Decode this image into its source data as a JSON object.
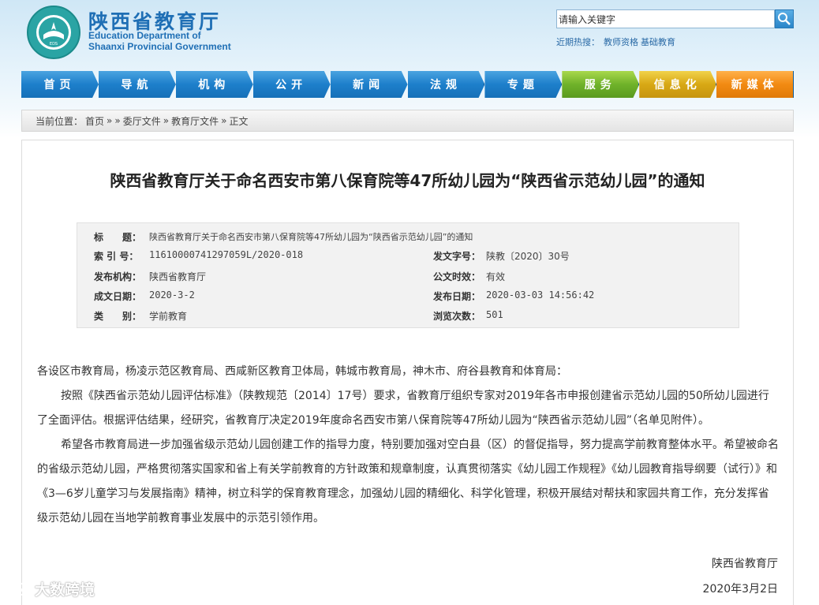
{
  "header": {
    "site_name_cn": "陕西省教育厅",
    "site_name_en_line1": "Education Department of",
    "site_name_en_line2": "Shaanxi Provincial Government",
    "logo_text_outer": "EDUCATION DEPARTMENT OF SHAANXI",
    "logo_text_inner": "EDS",
    "search_placeholder": "请输入关键字",
    "search_value": "请输入关键字",
    "hot_label": "近期热搜：",
    "hot_links": [
      "教师资格",
      "基础教育"
    ]
  },
  "nav": {
    "items": [
      {
        "label": "首页",
        "color": "blue"
      },
      {
        "label": "导航",
        "color": "blue"
      },
      {
        "label": "机构",
        "color": "blue"
      },
      {
        "label": "公开",
        "color": "blue"
      },
      {
        "label": "新闻",
        "color": "blue"
      },
      {
        "label": "法规",
        "color": "blue"
      },
      {
        "label": "专题",
        "color": "blue"
      },
      {
        "label": "服务",
        "color": "green"
      },
      {
        "label": "信息化",
        "color": "yellow"
      },
      {
        "label": "新媒体",
        "color": "orange"
      }
    ]
  },
  "breadcrumb": {
    "prefix": "当前位置：",
    "items": [
      "首页",
      "»",
      "»",
      "委厅文件",
      "»",
      "教育厅文件",
      "»",
      "正文"
    ]
  },
  "article": {
    "title": "陕西省教育厅关于命名西安市第八保育院等47所幼儿园为“陕西省示范幼儿园”的通知",
    "meta": {
      "title_label": "标　　题：",
      "title_value": "陕西省教育厅关于命名西安市第八保育院等47所幼儿园为“陕西省示范幼儿园”的通知",
      "index_label": "索  引  号：",
      "index_value": "11610000741297059L/2020-018",
      "doc_no_label": "发文字号：",
      "doc_no_value": "陕教〔2020〕30号",
      "org_label": "发布机构：",
      "org_value": "陕西省教育厅",
      "validity_label": "公文时效：",
      "validity_value": "有效",
      "created_label": "成文日期：",
      "created_value": "2020-3-2",
      "published_label": "发布日期：",
      "published_value": "2020-03-03 14:56:42",
      "category_label": "类　　别：",
      "category_value": "学前教育",
      "views_label": "浏览次数：",
      "views_value": "501"
    },
    "para1": "各设区市教育局，杨凌示范区教育局、西咸新区教育卫体局，韩城市教育局，神木市、府谷县教育和体育局：",
    "para2": "按照《陕西省示范幼儿园评估标准》（陕教规范〔2014〕17号）要求，省教育厅组织专家对2019年各市申报创建省示范幼儿园的50所幼儿园进行了全面评估。根据评估结果，经研究，省教育厅决定2019年度命名西安市第八保育院等47所幼儿园为“陕西省示范幼儿园”（名单见附件）。",
    "para3": "希望各市教育局进一步加强省级示范幼儿园创建工作的指导力度，特别要加强对空白县（区）的督促指导，努力提高学前教育整体水平。希望被命名的省级示范幼儿园，严格贯彻落实国家和省上有关学前教育的方针政策和规章制度，认真贯彻落实《幼儿园工作规程》《幼儿园教育指导纲要（试行）》和《3—6岁儿童学习与发展指南》精神，树立科学的保育教育理念，加强幼儿园的精细化、科学化管理，积极开展结对帮扶和家园共育工作，充分发挥省级示范幼儿园在当地学前教育事业发展中的示范引领作用。",
    "signature": "陕西省教育厅",
    "date": "2020年3月2日"
  },
  "watermark": "大数跨境"
}
